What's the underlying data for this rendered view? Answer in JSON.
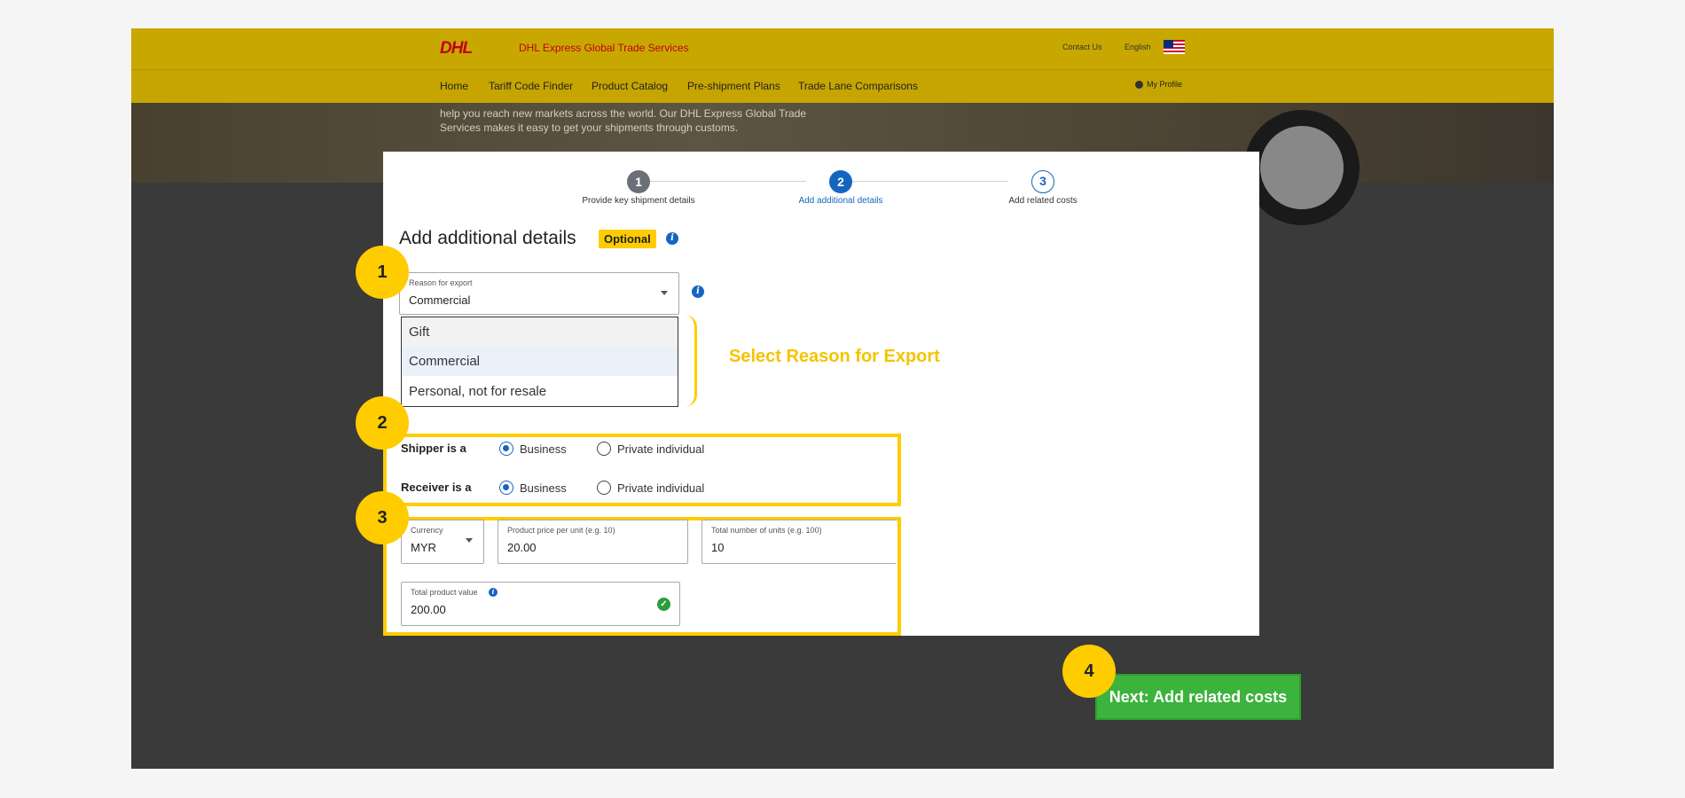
{
  "header": {
    "logo": "DHL",
    "service_name": "DHL Express Global Trade Services",
    "contact_us": "Contact Us",
    "language": "English",
    "flag_icon": "malaysia-flag-icon",
    "my_profile": "My Profile"
  },
  "nav": {
    "items": [
      {
        "label": "Home"
      },
      {
        "label": "Tariff Code Finder"
      },
      {
        "label": "Product Catalog"
      },
      {
        "label": "Pre-shipment Plans"
      },
      {
        "label": "Trade Lane Comparisons"
      }
    ]
  },
  "hero": {
    "text": "help you reach new markets across the world. Our DHL Express Global Trade Services makes it easy to get your shipments through customs."
  },
  "stepper": {
    "steps": [
      {
        "number": "1",
        "label": "Provide key shipment details",
        "state": "done",
        "color": "#6b6f77"
      },
      {
        "number": "2",
        "label": "Add additional details",
        "state": "active",
        "color": "#1565c0"
      },
      {
        "number": "3",
        "label": "Add related costs",
        "state": "upcoming",
        "color": "#1565c0"
      }
    ]
  },
  "form": {
    "heading": "Add additional details",
    "optional_badge": "Optional",
    "reason_for_export": {
      "label": "Reason for export",
      "value": "Commercial",
      "options": [
        "Gift",
        "Commercial",
        "Personal, not for resale"
      ]
    },
    "shipper": {
      "label": "Shipper is a",
      "options": [
        "Business",
        "Private individual"
      ],
      "selected": "Business"
    },
    "receiver": {
      "label": "Receiver is a",
      "options": [
        "Business",
        "Private individual"
      ],
      "selected": "Business"
    },
    "currency": {
      "label": "Currency",
      "value": "MYR"
    },
    "price_per_unit": {
      "label": "Product price per unit (e.g. 10)",
      "value": "20.00"
    },
    "total_units": {
      "label": "Total number of units (e.g. 100)",
      "value": "10"
    },
    "total_value": {
      "label": "Total product value",
      "value": "200.00"
    }
  },
  "annotations": {
    "select_reason": "Select Reason for Export",
    "badges": [
      "1",
      "2",
      "3",
      "4"
    ],
    "accent_color": "#ffcc00"
  },
  "next_button": {
    "label": "Next: Add related costs",
    "color": "#3cb33c"
  }
}
